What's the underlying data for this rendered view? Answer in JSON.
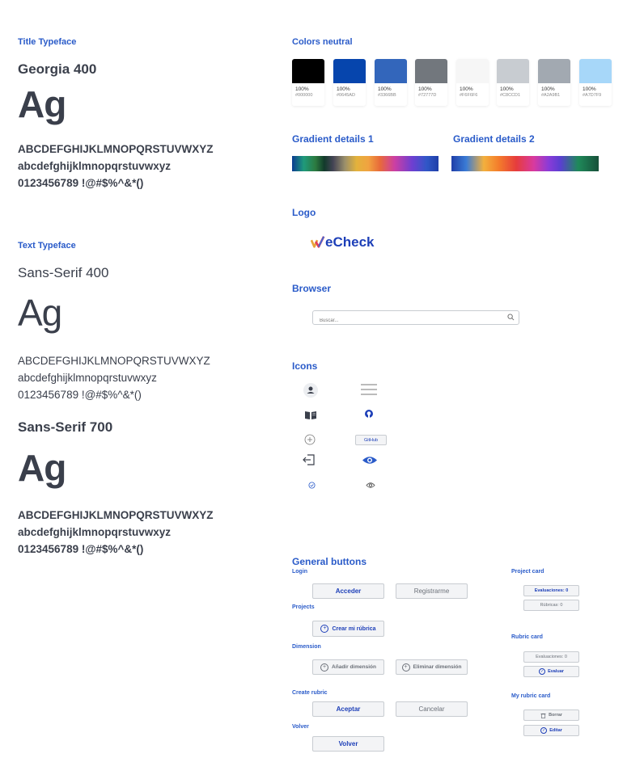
{
  "title_typeface": {
    "section": "Title Typeface",
    "font_label": "Georgia 400",
    "sample": "Ag",
    "upper": "ABCDEFGHIJKLMNOPQRSTUVWXYZ",
    "lower": "abcdefghijklmnopqrstuvwxyz",
    "digits": "0123456789 !@#$%^&*()"
  },
  "text_typeface": {
    "section": "Text Typeface",
    "regular_label": "Sans-Serif 400",
    "sample": "Ag",
    "upper": "ABCDEFGHIJKLMNOPQRSTUVWXYZ",
    "lower": "abcdefghijklmnopqrstuvwxyz",
    "digits": "0123456789 !@#$%^&*()",
    "bold_label": "Sans-Serif 700",
    "bold_sample": "Ag",
    "bold_upper": "ABCDEFGHIJKLMNOPQRSTUVWXYZ",
    "bold_lower": "abcdefghijklmnopqrstuvwxyz",
    "bold_digits": "0123456789 !@#$%^&*()"
  },
  "colors": {
    "section": "Colors neutral",
    "swatches": [
      {
        "pct": "100%",
        "hex": "#000000",
        "color": "#000000"
      },
      {
        "pct": "100%",
        "hex": "#0645AD",
        "color": "#0645AD"
      },
      {
        "pct": "100%",
        "hex": "#3366BB",
        "color": "#3366BB"
      },
      {
        "pct": "100%",
        "hex": "#72777D",
        "color": "#72777D"
      },
      {
        "pct": "100%",
        "hex": "#F6F6F6",
        "color": "#F6F6F6"
      },
      {
        "pct": "100%",
        "hex": "#C8CCD1",
        "color": "#C8CCD1"
      },
      {
        "pct": "100%",
        "hex": "#A2A9B1",
        "color": "#A2A9B1"
      },
      {
        "pct": "100%",
        "hex": "#A7D7F9",
        "color": "#A7D7F9"
      }
    ]
  },
  "gradients": {
    "label1": "Gradient details 1",
    "label2": "Gradient details 2"
  },
  "logo": {
    "section": "Logo",
    "text": "eCheck"
  },
  "browser": {
    "section": "Browser",
    "placeholder": "Buscar..."
  },
  "icons": {
    "section": "Icons",
    "github_button": "GitHub"
  },
  "buttons": {
    "section": "General buttons",
    "login_label": "Login",
    "acceder": "Acceder",
    "registrarme": "Registrarme",
    "projects_label": "Projects",
    "crear": "Crear mi rúbrica",
    "dimension_label": "Dimension",
    "anadir": "Añadir dimensión",
    "eliminar": "Eliminar dimensión",
    "create_rubric_label": "Create rubric",
    "aceptar": "Aceptar",
    "cancelar": "Cancelar",
    "volver_label": "Volver",
    "volver": "Volver"
  },
  "cards": {
    "project_card": "Project card",
    "evaluaciones": "Evaluaciones: 0",
    "rubricas": "Rúbricas: 0",
    "rubric_card": "Rubric card",
    "evaluaciones2": "Evaluaciones: 0",
    "evaluar": "Evaluar",
    "my_rubric_card": "My rubric card",
    "borrar": "Borrar",
    "editar": "Editar"
  },
  "accent_color": "#2a5bc9"
}
